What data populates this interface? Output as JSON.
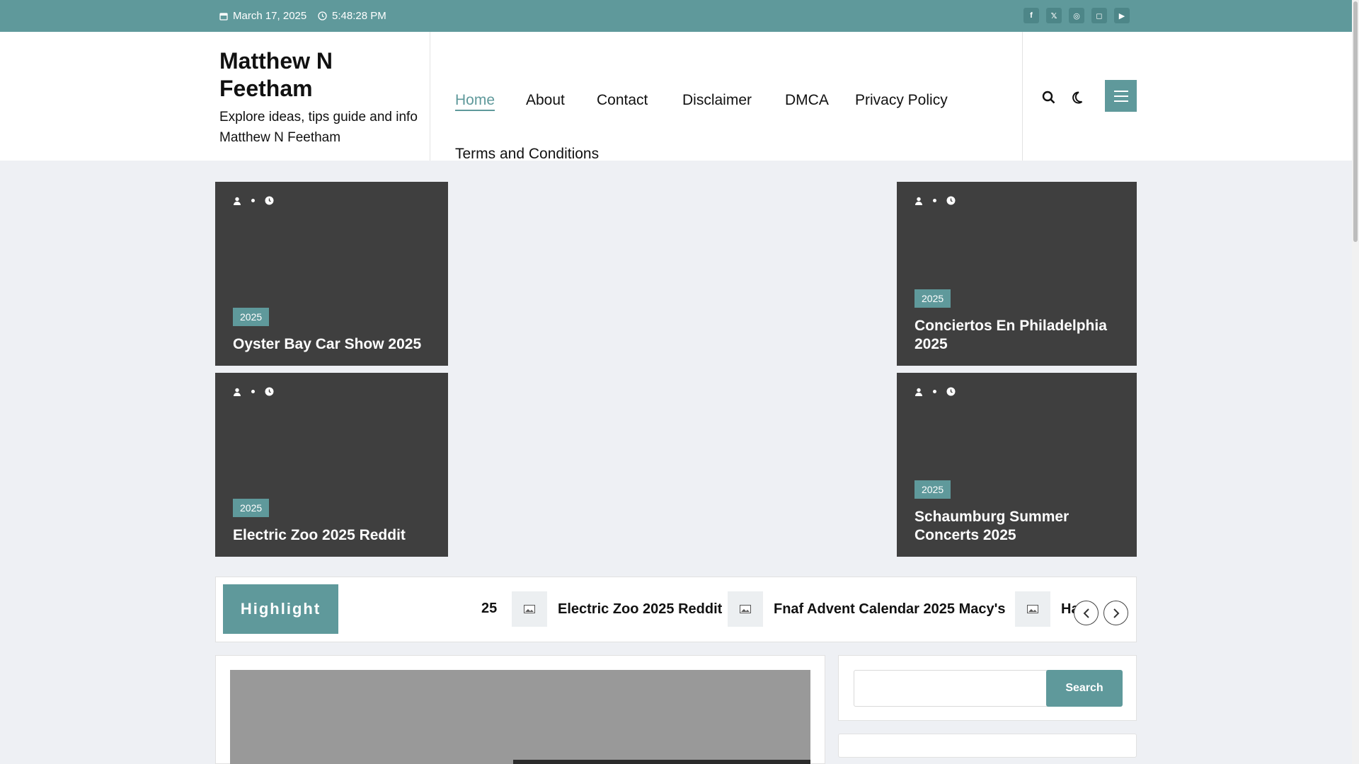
{
  "topbar": {
    "date": "March 17, 2025",
    "time": "5:48:28 PM",
    "socials": [
      "facebook-icon",
      "x-icon",
      "dribbble-icon",
      "instagram-icon",
      "youtube-icon"
    ]
  },
  "brand": {
    "title": "Matthew N Feetham",
    "tagline": "Explore ideas, tips guide and info Matthew N Feetham"
  },
  "nav": {
    "items": [
      "Home",
      "About",
      "Contact",
      "Disclaimer",
      "DMCA",
      "Privacy Policy",
      "Terms and Conditions"
    ],
    "active": "Home"
  },
  "featured": [
    {
      "tag": "2025",
      "title": "Oyster Bay Car Show 2025"
    },
    {
      "tag": "2025",
      "title": "Electric Zoo 2025 Reddit"
    },
    {
      "tag": "2025",
      "title": "Conciertos En Philadelphia 2025"
    },
    {
      "tag": "2025",
      "title": "Schaumburg Summer Concerts 2025"
    }
  ],
  "highlight": {
    "label": "Highlight",
    "cut_text": "25",
    "items": [
      "Electric Zoo 2025 Reddit",
      "Fnaf Advent Calendar 2025 Macy's",
      "Havre Festival Days"
    ]
  },
  "sidebar": {
    "search_button": "Search",
    "search_placeholder": ""
  },
  "colors": {
    "accent": "#5f999b",
    "card_bg": "#3f3f3f",
    "page_bg": "#eef0f4"
  }
}
